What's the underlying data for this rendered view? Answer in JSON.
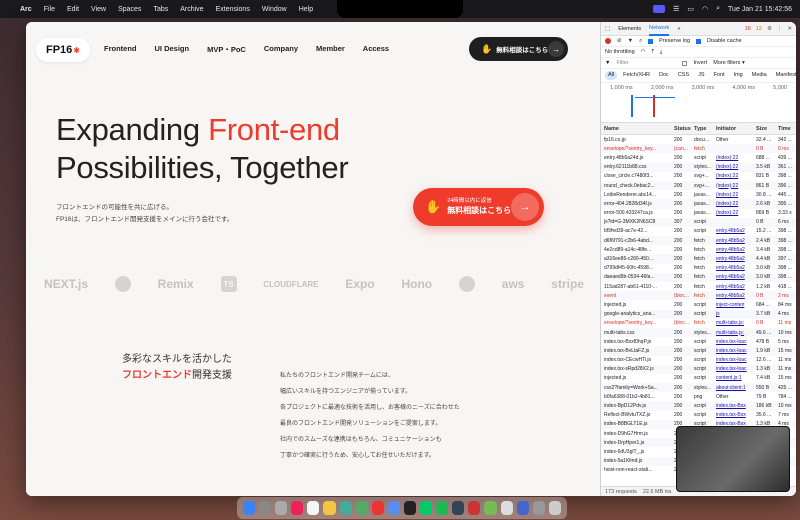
{
  "menubar": {
    "app": "Arc",
    "items": [
      "File",
      "Edit",
      "View",
      "Spaces",
      "Tabs",
      "Archive",
      "Extensions",
      "Window",
      "Help"
    ],
    "datetime": "Tue Jan 21  15:42:56"
  },
  "site": {
    "logo": "FP16",
    "nav": [
      "Frontend",
      "UI Design",
      "MVP・PoC",
      "Company",
      "Member",
      "Access"
    ],
    "header_button": "無料相談はこちら",
    "hero_line1_pre": "Expanding ",
    "hero_line1_accent": "Front-end",
    "hero_line2": "Possibilities, Together",
    "sub_line1": "フロントエンドの可能性を共に広げる。",
    "sub_line2": "FP16は、フロントエンド開発支援をメインに行う会社です。",
    "cta_small": "24時間以内に返信",
    "cta_big": "無料相談はこちら",
    "logos": [
      "NEXT.js",
      "Remix",
      "TS",
      "CLOUDFLARE",
      "Expo",
      "Hono",
      "aws",
      "stripe"
    ],
    "skills_title_line1": "多彩なスキルを活かした",
    "skills_title_accent": "フロントエンド",
    "skills_title_rest": "開発支援",
    "skills_body": [
      "私たちのフロントエンド開発チームには、",
      "幅広いスキルを持つエンジニアが揃っています。",
      "各プロジェクトに最適な技術を活用し、お客様のニーズに合わせた",
      "最良のフロントエンド開発ソリューションをご提案します。",
      "社内でのスムーズな連携はもちろん、コミュニケーションも",
      "丁寧かつ確実に行うため、安心してお任せいただけます。"
    ]
  },
  "devtools": {
    "tabs": [
      "Elements",
      "Network"
    ],
    "errors": "16",
    "warnings": "12",
    "preserve_log": "Preserve log",
    "disable_cache": "Disable cache",
    "throttling": "No throttling",
    "filter_placeholder": "Filter",
    "invert": "Invert",
    "more_filters": "More filters ▾",
    "type_filters": [
      "All",
      "Fetch/XHR",
      "Doc",
      "CSS",
      "JS",
      "Font",
      "Img",
      "Media",
      "Manifest",
      "WS"
    ],
    "timeline_ticks": [
      "1,000 ms",
      "2,000 ms",
      "3,000 ms",
      "4,000 ms",
      "5,000"
    ],
    "columns": [
      "Name",
      "Status",
      "Type",
      "Initiator",
      "Size",
      "Time"
    ],
    "rows": [
      {
        "name": "fp16.co.jp",
        "status": "200",
        "type": "docu...",
        "ini": "Other",
        "size": "32.4 ...",
        "time": "342 ...",
        "bad": false
      },
      {
        "name": "envelope/?sentry_key...",
        "status": "(can...",
        "type": "fetch",
        "ini": "",
        "size": "0 B",
        "time": "0 ms",
        "bad": true
      },
      {
        "name": "entry.48b5a24d.js",
        "status": "200",
        "type": "script",
        "ini": "(index):22",
        "size": "688 ...",
        "time": "439 ...",
        "bad": false
      },
      {
        "name": "entry.62111b88.css",
        "status": "200",
        "type": "styles...",
        "ini": "(index):22",
        "size": "3.5 kB",
        "time": "361 ...",
        "bad": false
      },
      {
        "name": "close_circle.c7480f3...",
        "status": "200",
        "type": "svg+...",
        "ini": "(index):22",
        "size": "831 B",
        "time": "398 ...",
        "bad": false
      },
      {
        "name": "round_check.0ebac2...",
        "status": "200",
        "type": "svg+...",
        "ini": "(index):22",
        "size": "861 B",
        "time": "396 ...",
        "bad": false
      },
      {
        "name": "LottieRenderer.abc14...",
        "status": "200",
        "type": "javas...",
        "ini": "(index):22",
        "size": "30.8 ...",
        "time": "445 ...",
        "bad": false
      },
      {
        "name": "error-404.2828d34f.js",
        "status": "200",
        "type": "javas...",
        "ini": "(index):22",
        "size": "2.6 kB",
        "time": "395 ...",
        "bad": false
      },
      {
        "name": "error-500.433247ca.js",
        "status": "200",
        "type": "javas...",
        "ini": "(index):22",
        "size": "869 B",
        "time": "3.33 s",
        "bad": false
      },
      {
        "name": "js?id=G-3MXK2N6SC8",
        "status": "307",
        "type": "script",
        "ini": "",
        "size": "0 B",
        "time": "6 ms",
        "bad": false
      },
      {
        "name": "bf9fed39-ac7e-42...",
        "status": "200",
        "type": "script",
        "ini": "entry.48b5a2",
        "size": "15.2 ...",
        "time": "398 ...",
        "bad": false
      },
      {
        "name": "d6f6f791-c2b6-4abd...",
        "status": "200",
        "type": "fetch",
        "ini": "entry.48b5a2",
        "size": "2.4 kB",
        "time": "398 ...",
        "bad": false
      },
      {
        "name": "4e2cd89-a14c-48fe...",
        "status": "200",
        "type": "fetch",
        "ini": "entry.48b5a2",
        "size": "3.4 kB",
        "time": "398 ...",
        "bad": false
      },
      {
        "name": "a316ee86-c266-450...",
        "status": "200",
        "type": "fetch",
        "ini": "entry.48b5a2",
        "size": "4.4 kB",
        "time": "397 ...",
        "bad": false
      },
      {
        "name": "d799df45-60fc-4598...",
        "status": "200",
        "type": "fetch",
        "ini": "entry.48b5a2",
        "size": "3.0 kB",
        "time": "398 ...",
        "bad": false
      },
      {
        "name": "daeaed9b-0534-46fa...",
        "status": "200",
        "type": "fetch",
        "ini": "entry.48b5a2",
        "size": "3.0 kB",
        "time": "398 ...",
        "bad": false
      },
      {
        "name": "115ad287-ab61-4110-...",
        "status": "200",
        "type": "fetch",
        "ini": "entry.48b5a2",
        "size": "1.2 kB",
        "time": "418 ...",
        "bad": false
      },
      {
        "name": "event",
        "status": "(bloc...",
        "type": "fetch",
        "ini": "entry.48b5a2",
        "size": "0 B",
        "time": "2 ms",
        "bad": true
      },
      {
        "name": "injected.js",
        "status": "200",
        "type": "script",
        "ini": "inject-conten",
        "size": "684 ...",
        "time": "84 ms",
        "bad": false
      },
      {
        "name": "google-analytics_ana...",
        "status": "200",
        "type": "script",
        "ini": "js",
        "size": "3.7 kB",
        "time": "4 ms",
        "bad": false
      },
      {
        "name": "envelope/?sentry_key...",
        "status": "(bloc...",
        "type": "fetch",
        "ini": "multi-tabs.js:",
        "size": "0 B",
        "time": "11 ms",
        "bad": true
      },
      {
        "name": "multi-tabs.css",
        "status": "200",
        "type": "styles...",
        "ini": "multi-tabs.js:",
        "size": "49.6 ...",
        "time": "10 ms",
        "bad": false
      },
      {
        "name": "index.tsx-Bxxf0hqP.js",
        "status": "200",
        "type": "script",
        "ini": "index.tsx-loac",
        "size": "478 B",
        "time": "5 ms",
        "bad": false
      },
      {
        "name": "index.tsx-BvLtaFZ.js",
        "status": "200",
        "type": "script",
        "ini": "index.tsx-loac",
        "size": "1.9 kB",
        "time": "15 ms",
        "bad": false
      },
      {
        "name": "index.tsx-CEcwHTi.js",
        "status": "200",
        "type": "script",
        "ini": "index.tsx-loac",
        "size": "12.6 ...",
        "time": "11 ms",
        "bad": false
      },
      {
        "name": "index.tsx-sRpd28X2.js",
        "status": "200",
        "type": "script",
        "ini": "index.tsx-loac",
        "size": "1.3 kB",
        "time": "11 ms",
        "bad": false
      },
      {
        "name": "injected.js",
        "status": "200",
        "type": "script",
        "ini": "content.js:1",
        "size": "7.4 kB",
        "time": "15 ms",
        "bad": false
      },
      {
        "name": "css2?family=Work+Sa...",
        "status": "200",
        "type": "styles...",
        "ini": "about:client:1",
        "size": "550 B",
        "time": "425 ...",
        "bad": false
      },
      {
        "name": "b0fa6388-01b2-4b81...",
        "status": "200",
        "type": "png",
        "ini": "Other",
        "size": "79 B",
        "time": "784 ...",
        "bad": false
      },
      {
        "name": "index-BpD12Pdv.js",
        "status": "200",
        "type": "script",
        "ini": "index.tsx-Bsx",
        "size": "186 kB",
        "time": "10 ms",
        "bad": false
      },
      {
        "name": "Reflect-BWvtuTXZ.js",
        "status": "200",
        "type": "script",
        "ini": "index.tsx-Bsx",
        "size": "35.6 ...",
        "time": "7 ms",
        "bad": false
      },
      {
        "name": "index-B8BGLT1E.js",
        "status": "200",
        "type": "script",
        "ini": "index.tsx-Bsx",
        "size": "1.3 kB",
        "time": "4 ms",
        "bad": false
      },
      {
        "name": "index-D9hG7Hrm.js",
        "status": "200",
        "type": "script",
        "ini": "",
        "size": "",
        "time": "",
        "bad": false
      },
      {
        "name": "index-DrpHper1.js",
        "status": "200",
        "type": "script",
        "ini": "",
        "size": "",
        "time": "",
        "bad": false
      },
      {
        "name": "index-6dU3glT_.js",
        "status": "200",
        "type": "script",
        "ini": "",
        "size": "",
        "time": "",
        "bad": false
      },
      {
        "name": "index-5a1Klmd.js",
        "status": "200",
        "type": "script",
        "ini": "",
        "size": "",
        "time": "",
        "bad": false
      },
      {
        "name": "hoist-non-react-stati...",
        "status": "200",
        "type": "script",
        "ini": "",
        "size": "",
        "time": "",
        "bad": false
      }
    ],
    "footer_requests": "173 requests",
    "footer_transferred": "22.6 MB tra"
  }
}
